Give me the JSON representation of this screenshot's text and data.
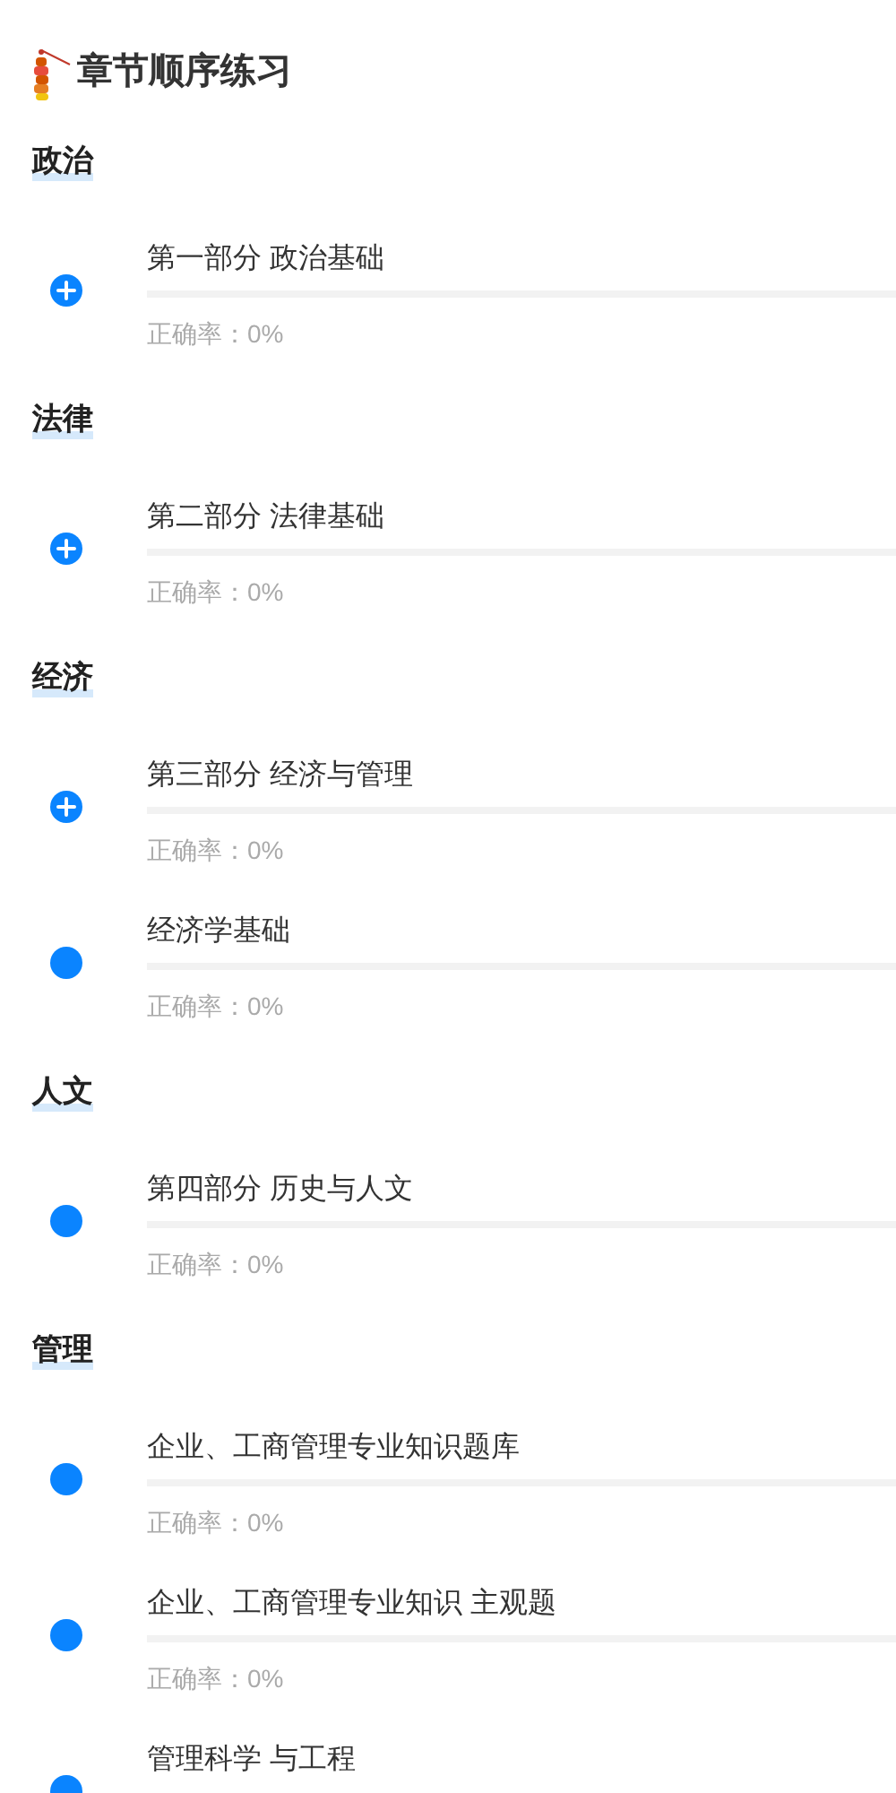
{
  "title": "章节顺序练习",
  "sections": [
    {
      "heading": "政治",
      "items": [
        {
          "kind": "expandable",
          "title": "第一部分 政治基础",
          "accuracy": "正确率：0%"
        }
      ]
    },
    {
      "heading": "法律",
      "items": [
        {
          "kind": "expandable",
          "title": "第二部分 法律基础",
          "accuracy": "正确率：0%"
        }
      ]
    },
    {
      "heading": "经济",
      "items": [
        {
          "kind": "expandable",
          "title": "第三部分 经济与管理",
          "accuracy": "正确率：0%"
        },
        {
          "kind": "leaf",
          "title": "经济学基础",
          "accuracy": "正确率：0%"
        }
      ]
    },
    {
      "heading": "人文",
      "items": [
        {
          "kind": "leaf",
          "title": "第四部分 历史与人文",
          "accuracy": "正确率：0%"
        }
      ]
    },
    {
      "heading": "管理",
      "items": [
        {
          "kind": "leaf",
          "title": "企业、工商管理专业知识题库",
          "accuracy": "正确率：0%"
        },
        {
          "kind": "leaf",
          "title": "企业、工商管理专业知识 主观题",
          "accuracy": "正确率：0%"
        },
        {
          "kind": "leaf",
          "title": "管理科学 与工程"
        }
      ]
    }
  ]
}
